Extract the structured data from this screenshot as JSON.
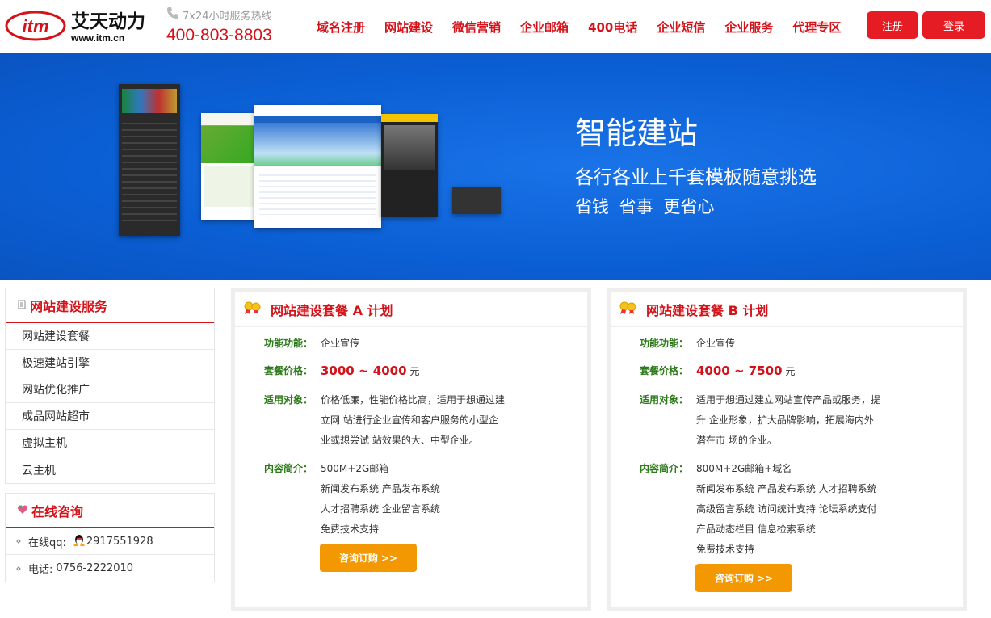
{
  "header": {
    "logo_text": "艾天动力",
    "logo_url_text": "www.itm.cn",
    "logo_mark": "itm",
    "hotline_label": "7x24小时服务热线",
    "hotline_phone": "400-803-8803",
    "nav": [
      "域名注册",
      "网站建设",
      "微信营销",
      "企业邮箱",
      "400电话",
      "企业短信",
      "企业服务",
      "代理专区"
    ],
    "register_label": "注册",
    "login_label": "登录"
  },
  "banner": {
    "title": "智能建站",
    "subtitle": "各行各业上千套模板随意挑选",
    "subtitle2": "省钱  省事  更省心"
  },
  "services": {
    "title": "网站建设服务",
    "items": [
      "网站建设套餐",
      "极速建站引擎",
      "网站优化推广",
      "成品网站超市",
      "虚拟主机",
      "云主机"
    ]
  },
  "consult": {
    "title": "在线咨询",
    "qq_label": "在线qq:",
    "qq_value": "2917551928",
    "phone_label": "电话:",
    "phone_value": "0756-2222010"
  },
  "plan_a": {
    "title": "网站建设套餐 A 计划",
    "func_label": "功能功能：",
    "func_value": "企业宣传",
    "price_label": "套餐价格：",
    "price_value": "3000 ~ 4000",
    "price_unit": "元",
    "target_label": "适用对象：",
    "target_lines": [
      "价格低廉，性能价格比高，适用于想通过建",
      "立网 站进行企业宣传和客户服务的小型企",
      "业或想尝试 站效果的大、中型企业。"
    ],
    "content_label": "内容简介：",
    "content_lines": [
      "500M+2G邮箱",
      "新闻发布系统 产品发布系统",
      "人才招聘系统 企业留言系统",
      "免费技术支持"
    ],
    "order_label": "咨询订购 >>"
  },
  "plan_b": {
    "title": "网站建设套餐 B 计划",
    "func_label": "功能功能：",
    "func_value": "企业宣传",
    "price_label": "套餐价格：",
    "price_value": "4000 ~ 7500",
    "price_unit": "元",
    "target_label": "适用对象：",
    "target_lines": [
      "适用于想通过建立网站宣传产品或服务，提",
      "升 企业形象，扩大品牌影响，拓展海内外",
      "潜在市 场的企业。"
    ],
    "content_label": "内容简介：",
    "content_lines": [
      "800M+2G邮箱+域名",
      "新闻发布系统 产品发布系统 人才招聘系统",
      "高级留言系统 访问统计支持 论坛系统支付",
      "产品动态栏目 信息检索系统",
      "免费技术支持"
    ],
    "order_label": "咨询订购 >>"
  },
  "colors": {
    "brand_red": "#d4121a",
    "banner_blue": "#0b5fd4",
    "order_orange": "#f39800",
    "label_green": "#2d7a1a"
  },
  "icons": {
    "phone": "phone-icon",
    "doc": "document-icon",
    "heart": "heart-icon",
    "qq": "qq-penguin-icon",
    "award": "award-ribbon-icon"
  }
}
